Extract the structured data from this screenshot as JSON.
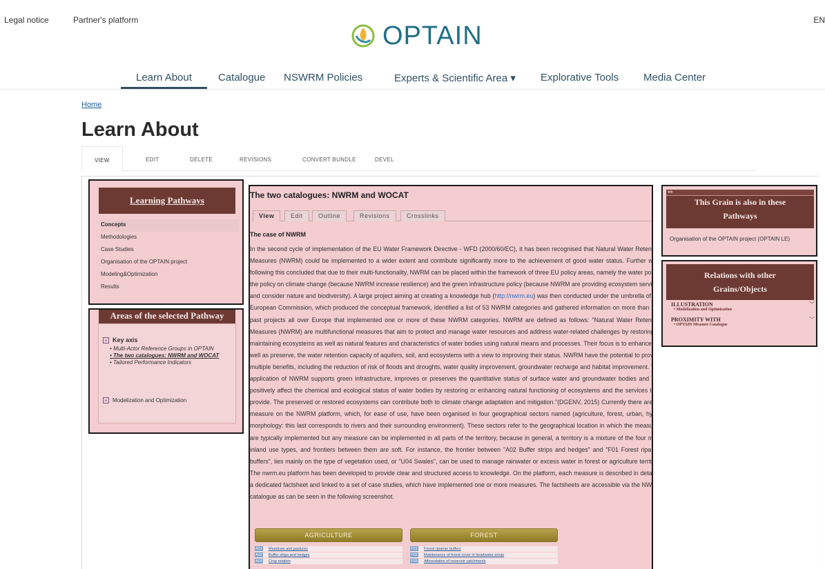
{
  "topbar": {
    "legal_notice": "Legal notice",
    "partners_platform": "Partner's platform",
    "language": "EN"
  },
  "logo": {
    "text": "OPTAIN"
  },
  "nav": {
    "items": [
      "Learn About",
      "Catalogue",
      "NSWRM Policies",
      "Experts & Scientific Area ▾",
      "Explorative Tools",
      "Media Center"
    ],
    "active": "Learn About"
  },
  "breadcrumb": {
    "home": "Home"
  },
  "page": {
    "title": "Learn About"
  },
  "admin_tabs": [
    "VIEW",
    "EDIT",
    "DELETE",
    "REVISIONS",
    "CONVERT BUNDLE",
    "DEVEL"
  ],
  "learning_pathways": {
    "heading": "Learning Pathways",
    "items": [
      "Concepts",
      "Methodologies",
      "Case Studies",
      "Organisation of the OPTAIN project",
      "Modeling&Optimization",
      "Results"
    ],
    "active": "Concepts"
  },
  "areas": {
    "heading": "Areas of the selected Pathway",
    "group1": {
      "label": "Key axis",
      "items": [
        "Multi-Actor Reference Groups in OPTAIN",
        "The two catalogues: NWRM and WOCAT",
        "Tailored Performance Indicators"
      ]
    },
    "group2": {
      "label": "Modelization and Optimization"
    }
  },
  "article": {
    "title": "The two catalogues: NWRM and WOCAT",
    "subtabs": [
      "View",
      "Edit",
      "Outline",
      "Revisions",
      "Crosslinks"
    ],
    "case_heading": "The case of NWRM",
    "body_before_link": "In the second cycle of implementation of the EU Water Framework Directive - WFD (2000/60/EC), it has been recognised that Natural Water Retention Measures (NWRM) could be implemented to a wider extent and contribute significantly more to the achievement of good water status. Further work following this concluded that due to their multi-functionality, NWRM can be placed within the framework of three EU policy areas, namely the water policy, the policy on climate change (because NWRM increase resilience) and the green infrastructure policy (because NWRM are providing ecosystem services and consider nature and biodiversity). A large project aiming at creating a knowledge hub (",
    "link": "http://nwrm.eu",
    "body_after_link": ") was then conducted under the umbrella of the European Commission, which produced the conceptual framework, identified a list of 53 NWRM categories and gathered information on more than 130 past projects all over Europe that implemented one or more of these NWRM categories. NWRM are defined as follows: \"Natural Water Retention Measures (NWRM) are multifunctional measures that aim to protect and manage water resources and address water-related challenges by restoring or maintaining ecosystems as well as natural features and characteristics of water bodies using natural means and processes. Their focus is to enhance, as well as preserve, the water retention capacity of aquifers, soil, and ecosystems with a view to improving their status. NWRM have the potential to provide multiple benefits, including the reduction of risk of floods and droughts, water quality improvement, groundwater recharge and habitat improvement. The application of NWRM supports green infrastructure, improves or preserves the quantitative status of surface water and groundwater bodies and can positively affect the chemical and ecological status of water bodies by restoring or enhancing natural functioning of ecosystems and the services they provide. The preserved or restored ecosystems can contribute both to climate change adaptation and mitigation.\"(DGENV, 2015) Currently there are 53 measure on the NWRM platform, which, for ease of use, have been organised in four geographical sectors named (agriculture, forest, urban, hydro morphology: this last corresponds to rivers and their surrounding environment). These sectors refer to the geographical location in which the measures are typically implemented but any measure can be implemented in all parts of the territory, because in general, a territory is a mixture of the four main inland use types, and frontiers between them are soft. For instance, the frontier between \"A02 Buffer strips and hedges\" and \"F01 Forest riparian buffers\", lies mainly on the type of vegetation used, or \"U04 Swales\", can be used to manage rainwater or excess water in forest or agriculture territory. The nwrm.eu platform has been developed to provide clear and structured access to knowledge. On the platform, each measure is described in detail in a dedicated factsheet and linked to a set of case studies, which have implemented one or more measures. The factsheets are accessible via the NWRM catalogue as can be seen in the following screenshot."
  },
  "screenshot": {
    "agriculture": {
      "label": "AGRICULTURE",
      "rows": [
        {
          "code": "A01",
          "label": "Meadows and pastures"
        },
        {
          "code": "A02",
          "label": "Buffer strips and hedges"
        },
        {
          "code": "A03",
          "label": "Crop rotation"
        }
      ]
    },
    "forest": {
      "label": "FOREST",
      "rows": [
        {
          "code": "F01",
          "label": "Forest riparian buffers"
        },
        {
          "code": "F02",
          "label": "Maintenance of forest cover in headwater areas"
        },
        {
          "code": "F03",
          "label": "Afforestation of reservoir catchments"
        }
      ]
    }
  },
  "grain": {
    "mini": "▸▸",
    "heading_line1": "This Grain is also in these",
    "heading_line2": "Pathways",
    "text": "Organisation of the OPTAIN project (OPTAIN LE)"
  },
  "relations": {
    "heading_line1": "Relations with other",
    "heading_line2": "Grains/Objects",
    "section1": {
      "label": "ILLUSTRATION",
      "item": "Modelization and Optimization"
    },
    "section2": {
      "label": "PROXIMITY WITH",
      "item": "OPTAIN Measure Catalogue"
    }
  },
  "colors": {
    "highlight_bg": "#f3cdd0",
    "brown": "#6d3a33",
    "brand": "#1f6f86",
    "nav_text": "#2f4f62",
    "olive_button": "#a08c3a"
  }
}
